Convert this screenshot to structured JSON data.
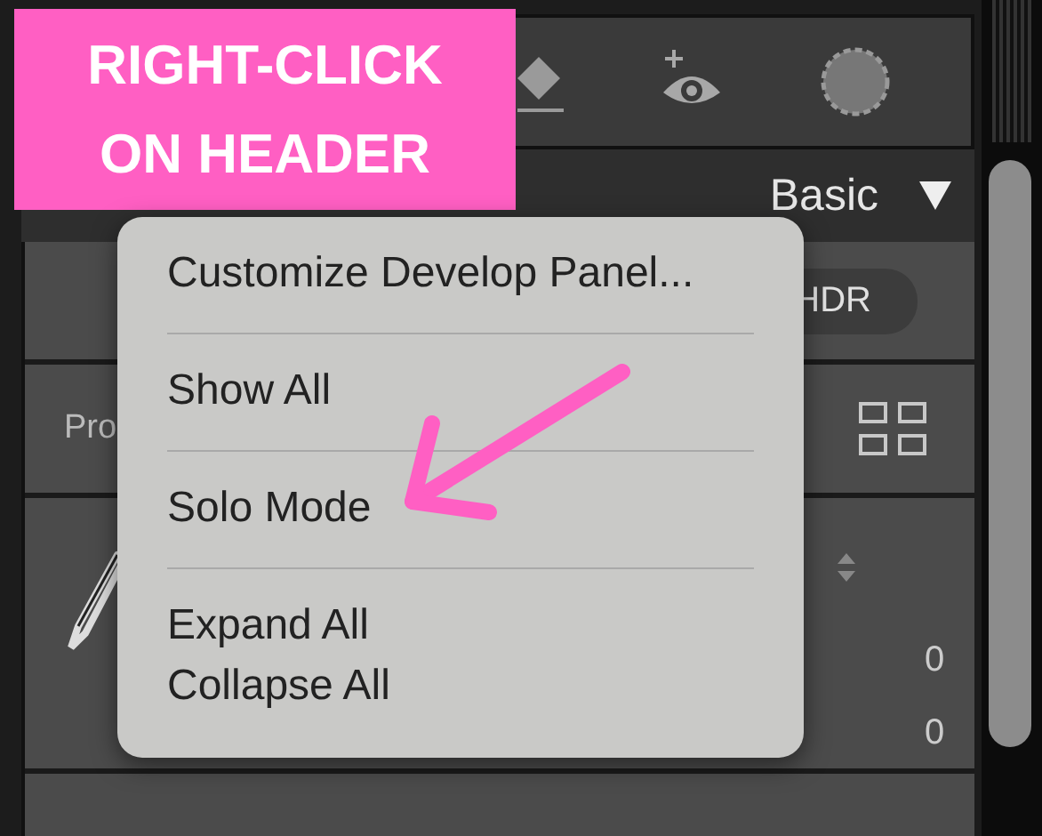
{
  "annotation": {
    "lines": [
      "RIGHT-CLICK",
      "ON HEADER"
    ]
  },
  "panel": {
    "title": "Basic",
    "hdr_button": "HDR",
    "profile_label": "Pro",
    "values": [
      "0",
      "0"
    ]
  },
  "context_menu": {
    "items": [
      {
        "kind": "item",
        "label": "Customize Develop Panel..."
      },
      {
        "kind": "separator"
      },
      {
        "kind": "item",
        "label": "Show All"
      },
      {
        "kind": "separator"
      },
      {
        "kind": "item",
        "label": "Solo Mode"
      },
      {
        "kind": "separator"
      },
      {
        "kind": "item",
        "label": "Expand All"
      },
      {
        "kind": "item",
        "label": "Collapse All"
      }
    ]
  }
}
